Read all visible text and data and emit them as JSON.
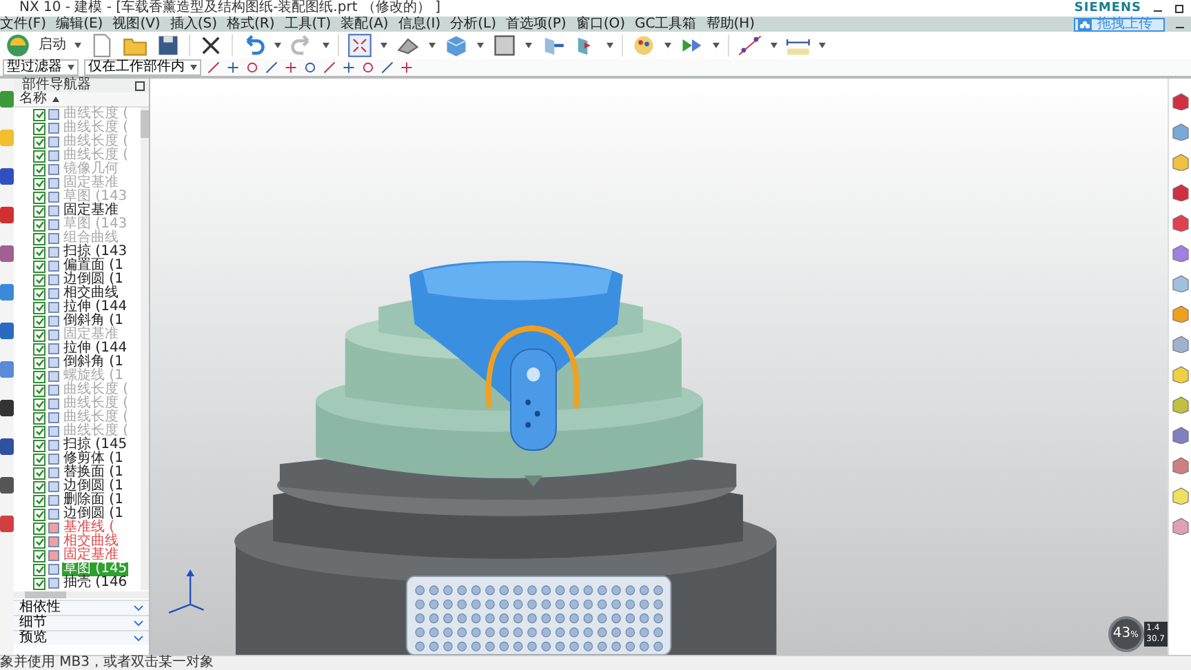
{
  "window": {
    "title": "NX 10 - 建模 - [车载香薰造型及结构图纸-装配图纸.prt （修改的） ]",
    "brand": "SIEMENS"
  },
  "menu": [
    {
      "label": "文件(F)"
    },
    {
      "label": "编辑(E)"
    },
    {
      "label": "视图(V)"
    },
    {
      "label": "插入(S)"
    },
    {
      "label": "格式(R)"
    },
    {
      "label": "工具(T)"
    },
    {
      "label": "装配(A)"
    },
    {
      "label": "信息(I)"
    },
    {
      "label": "分析(L)"
    },
    {
      "label": "首选项(P)"
    },
    {
      "label": "窗口(O)"
    },
    {
      "label": "GC工具箱"
    },
    {
      "label": "帮助(H)"
    }
  ],
  "cloud_button": "拖拽上传",
  "toolbar": {
    "start_label": "启动"
  },
  "filter_bar": {
    "type_filter": "型过滤器",
    "scope_filter": "仅在工作部件内"
  },
  "part_navigator": {
    "title": "部件导航器",
    "column": "名称",
    "items": [
      {
        "label": "曲线长度 (",
        "kind": "inactive",
        "checked": true,
        "selected": false
      },
      {
        "label": "曲线长度 (",
        "kind": "inactive",
        "checked": true,
        "selected": false
      },
      {
        "label": "曲线长度 (",
        "kind": "inactive",
        "checked": true,
        "selected": false
      },
      {
        "label": "曲线长度 (",
        "kind": "inactive",
        "checked": true,
        "selected": false
      },
      {
        "label": "镜像几何",
        "kind": "inactive",
        "checked": true,
        "selected": false
      },
      {
        "label": "固定基准",
        "kind": "inactive",
        "checked": true,
        "selected": false
      },
      {
        "label": "草图 (143",
        "kind": "inactive",
        "checked": true,
        "selected": false
      },
      {
        "label": "固定基准",
        "kind": "active",
        "checked": true,
        "selected": false
      },
      {
        "label": "草图 (143",
        "kind": "inactive",
        "checked": true,
        "selected": false
      },
      {
        "label": "组合曲线",
        "kind": "inactive",
        "checked": true,
        "selected": false
      },
      {
        "label": "扫掠 (143",
        "kind": "active",
        "checked": true,
        "selected": false
      },
      {
        "label": "偏置面 (1",
        "kind": "active",
        "checked": true,
        "selected": false
      },
      {
        "label": "边倒圆 (1",
        "kind": "active",
        "checked": true,
        "selected": false
      },
      {
        "label": "相交曲线",
        "kind": "active",
        "checked": true,
        "selected": false
      },
      {
        "label": "拉伸 (144",
        "kind": "active",
        "checked": true,
        "selected": false
      },
      {
        "label": "倒斜角 (1",
        "kind": "active",
        "checked": true,
        "selected": false
      },
      {
        "label": "固定基准",
        "kind": "inactive",
        "checked": true,
        "selected": false
      },
      {
        "label": "拉伸 (144",
        "kind": "active",
        "checked": true,
        "selected": false
      },
      {
        "label": "倒斜角 (1",
        "kind": "active",
        "checked": true,
        "selected": false
      },
      {
        "label": "螺旋线 (1",
        "kind": "inactive",
        "checked": true,
        "selected": false
      },
      {
        "label": "曲线长度 (",
        "kind": "inactive",
        "checked": true,
        "selected": false
      },
      {
        "label": "曲线长度 (",
        "kind": "inactive",
        "checked": true,
        "selected": false
      },
      {
        "label": "曲线长度 (",
        "kind": "inactive",
        "checked": true,
        "selected": false
      },
      {
        "label": "曲线长度 (",
        "kind": "inactive",
        "checked": true,
        "selected": false
      },
      {
        "label": "扫掠 (145",
        "kind": "active",
        "checked": true,
        "selected": false
      },
      {
        "label": "修剪体 (1",
        "kind": "active",
        "checked": true,
        "selected": false
      },
      {
        "label": "替换面 (1",
        "kind": "active",
        "checked": true,
        "selected": false
      },
      {
        "label": "边倒圆 (1",
        "kind": "active",
        "checked": true,
        "selected": false
      },
      {
        "label": "删除面 (1",
        "kind": "active",
        "checked": true,
        "selected": false
      },
      {
        "label": "边倒圆 (1",
        "kind": "active",
        "checked": true,
        "selected": false
      },
      {
        "label": "基准线 (",
        "kind": "warning",
        "checked": true,
        "selected": false
      },
      {
        "label": "相交曲线",
        "kind": "warning",
        "checked": true,
        "selected": false
      },
      {
        "label": "固定基准",
        "kind": "warning",
        "checked": true,
        "selected": false
      },
      {
        "label": "草图 (145",
        "kind": "active",
        "checked": true,
        "selected": true
      },
      {
        "label": "抽壳 (146",
        "kind": "active",
        "checked": true,
        "selected": false
      }
    ],
    "sections": [
      {
        "label": "相依性"
      },
      {
        "label": "细节"
      },
      {
        "label": "预览"
      }
    ]
  },
  "status_bar": "象并使用 MB3，或者双击某一对象",
  "speed_widget": {
    "percent": "43",
    "unit": "%",
    "upload": "1.4",
    "download": "30.7"
  }
}
